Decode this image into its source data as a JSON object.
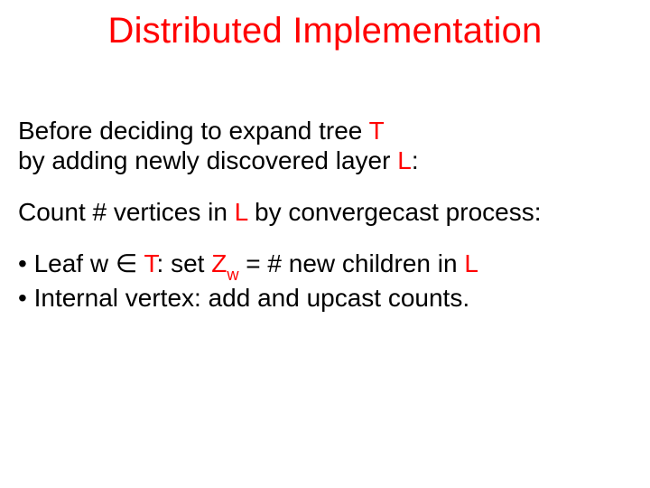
{
  "title": "Distributed Implementation",
  "para1_a": "Before deciding to expand tree ",
  "para1_T": "T",
  "para1_b": "by adding newly discovered layer ",
  "para1_L": "L",
  "para1_c": ":",
  "para2_a": "Count # vertices in ",
  "para2_L": "L",
  "para2_b": " by convergecast process:",
  "b1_dot": "• ",
  "b1_a": "Leaf w ∈ ",
  "b1_T": "T",
  "b1_b": ": set ",
  "b1_Z": "Z",
  "b1_w": "w",
  "b1_c": " = # new children in ",
  "b1_L": "L",
  "b2_dot": "• ",
  "b2_a": "Internal vertex: add and upcast counts."
}
